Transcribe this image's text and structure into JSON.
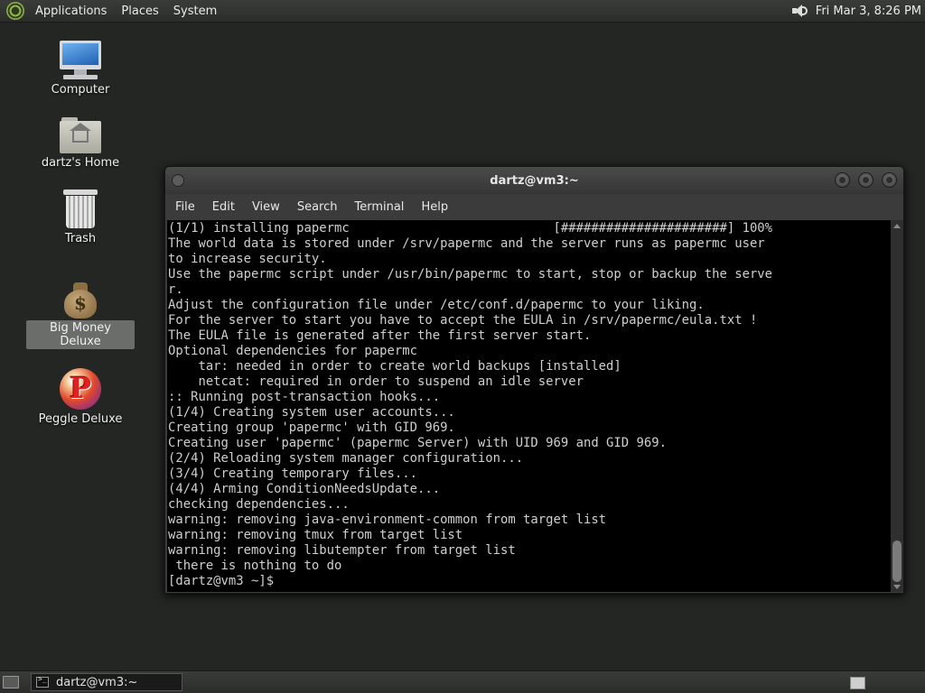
{
  "top_panel": {
    "menus": [
      "Applications",
      "Places",
      "System"
    ],
    "clock": "Fri Mar  3,  8:26 PM"
  },
  "desktop_icons": [
    {
      "label": "Computer",
      "icon": "computer-icon"
    },
    {
      "label": "dartz's Home",
      "icon": "home-folder-icon"
    },
    {
      "label": "Trash",
      "icon": "trash-icon"
    },
    {
      "label": "Big Money Deluxe",
      "icon": "money-bag-icon",
      "selected": true
    },
    {
      "label": "Peggle Deluxe",
      "icon": "peggle-icon"
    }
  ],
  "terminal": {
    "title": "dartz@vm3:~",
    "menu": [
      "File",
      "Edit",
      "View",
      "Search",
      "Terminal",
      "Help"
    ],
    "lines": [
      "(1/1) installing papermc                           [######################] 100%",
      "The world data is stored under /srv/papermc and the server runs as papermc user",
      "to increase security.",
      "Use the papermc script under /usr/bin/papermc to start, stop or backup the serve",
      "r.",
      "Adjust the configuration file under /etc/conf.d/papermc to your liking.",
      "For the server to start you have to accept the EULA in /srv/papermc/eula.txt !",
      "The EULA file is generated after the first server start.",
      "Optional dependencies for papermc",
      "    tar: needed in order to create world backups [installed]",
      "    netcat: required in order to suspend an idle server",
      ":: Running post-transaction hooks...",
      "(1/4) Creating system user accounts...",
      "Creating group 'papermc' with GID 969.",
      "Creating user 'papermc' (papermc Server) with UID 969 and GID 969.",
      "(2/4) Reloading system manager configuration...",
      "(3/4) Creating temporary files...",
      "(4/4) Arming ConditionNeedsUpdate...",
      "checking dependencies...",
      "warning: removing java-environment-common from target list",
      "warning: removing tmux from target list",
      "warning: removing libutempter from target list",
      " there is nothing to do",
      "[dartz@vm3 ~]$ "
    ]
  },
  "taskbar": {
    "task_label": "dartz@vm3:~"
  }
}
